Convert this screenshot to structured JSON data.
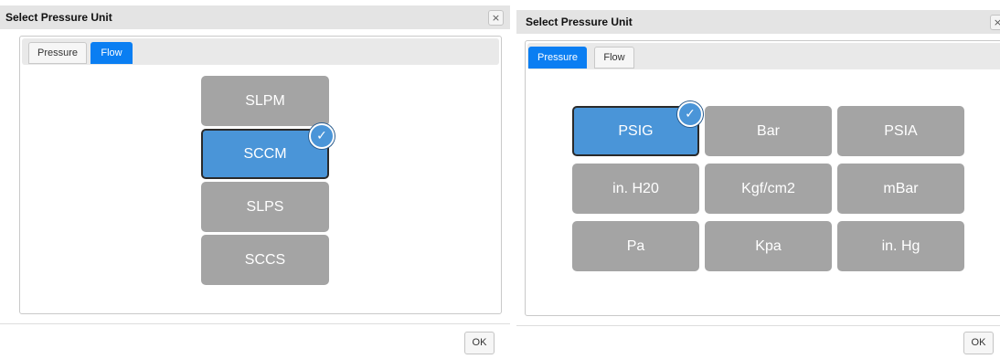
{
  "left_dialog": {
    "title": "Select Pressure Unit",
    "close_glyph": "×",
    "tabs": [
      {
        "label": "Pressure",
        "active": false
      },
      {
        "label": "Flow",
        "active": true
      }
    ],
    "units": [
      {
        "label": "SLPM",
        "selected": false
      },
      {
        "label": "SCCM",
        "selected": true
      },
      {
        "label": "SLPS",
        "selected": false
      },
      {
        "label": "SCCS",
        "selected": false
      }
    ],
    "check_glyph": "✓",
    "ok_label": "OK"
  },
  "right_dialog": {
    "title": "Select Pressure Unit",
    "close_glyph": "×",
    "tabs": [
      {
        "label": "Pressure",
        "active": true
      },
      {
        "label": "Flow",
        "active": false
      }
    ],
    "units": [
      {
        "label": "PSIG",
        "selected": true
      },
      {
        "label": "Bar",
        "selected": false
      },
      {
        "label": "PSIA",
        "selected": false
      },
      {
        "label": "in. H20",
        "selected": false
      },
      {
        "label": "Kgf/cm2",
        "selected": false
      },
      {
        "label": "mBar",
        "selected": false
      },
      {
        "label": "Pa",
        "selected": false
      },
      {
        "label": "Kpa",
        "selected": false
      },
      {
        "label": "in. Hg",
        "selected": false
      }
    ],
    "check_glyph": "✓",
    "ok_label": "OK"
  },
  "colors": {
    "accent": "#0a7ef2",
    "selected_fill": "#4a95d8",
    "unit_fill": "#a4a4a4"
  },
  "icons": {
    "close": "close-icon",
    "check": "checkmark-icon"
  }
}
